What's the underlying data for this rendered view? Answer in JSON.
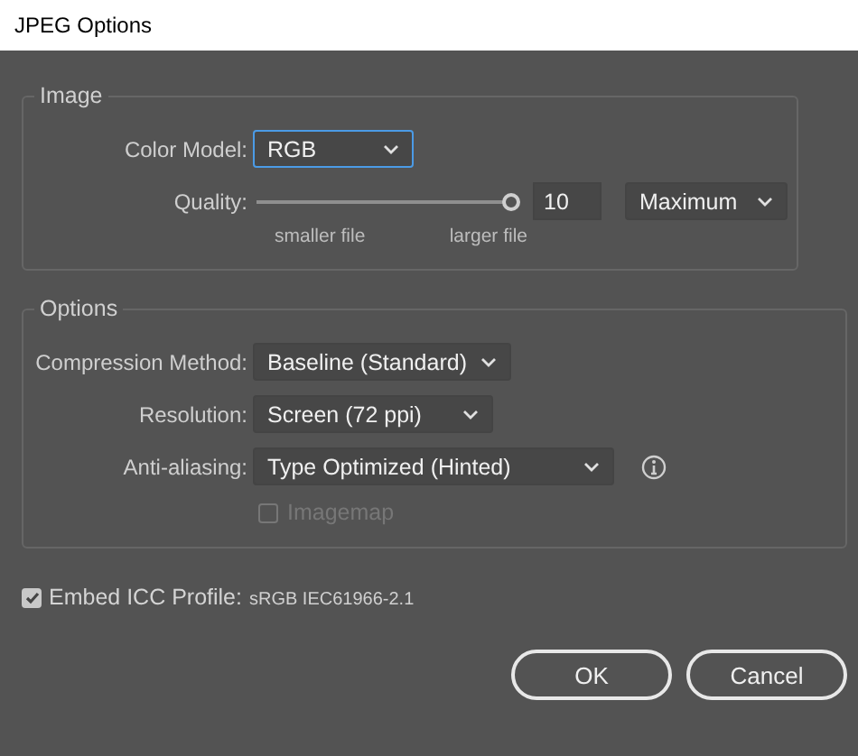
{
  "window": {
    "title": "JPEG Options"
  },
  "image_group": {
    "legend": "Image",
    "color_model": {
      "label": "Color Model:",
      "value": "RGB",
      "focused": true
    },
    "quality": {
      "label": "Quality:",
      "level": 1,
      "value": "10",
      "preset": "Maximum",
      "min_label": "smaller file",
      "max_label": "larger file"
    }
  },
  "options_group": {
    "legend": "Options",
    "rows": [
      {
        "label": "Compression Method:",
        "value": "Baseline (Standard)",
        "info": false
      },
      {
        "label": "Resolution:",
        "value": "Screen (72 ppi)",
        "info": false
      },
      {
        "label": "Anti-aliasing:",
        "value": "Type Optimized (Hinted)",
        "info": true
      }
    ],
    "imagemap": {
      "label": "Imagemap",
      "checked": false,
      "disabled": true
    }
  },
  "embed_icc": {
    "label": "Embed ICC Profile:",
    "profile": "sRGB IEC61966-2.1",
    "checked": true
  },
  "buttons": [
    {
      "label": "OK"
    },
    {
      "label": "Cancel"
    }
  ]
}
